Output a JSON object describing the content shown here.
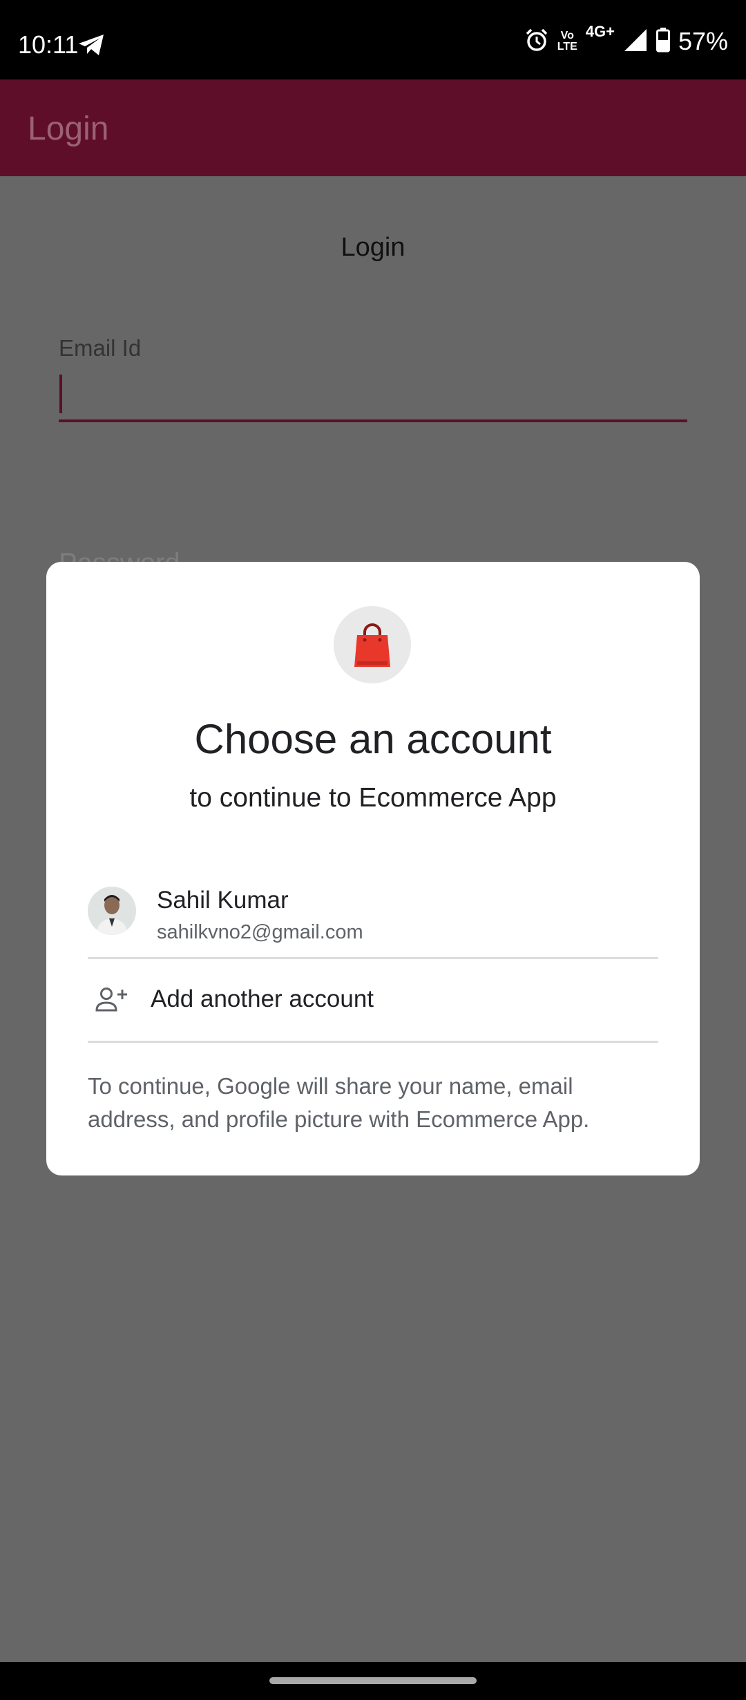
{
  "status_bar": {
    "time": "10:11",
    "volte_top": "Vo",
    "volte_bottom": "LTE",
    "network": "4G+",
    "battery": "57%"
  },
  "app_bar": {
    "title": "Login"
  },
  "login_form": {
    "heading": "Login",
    "email_label": "Email Id",
    "email_value": "",
    "password_label": "Password"
  },
  "dialog": {
    "title": "Choose an account",
    "subtitle": "to continue to Ecommerce App",
    "account": {
      "name": "Sahil Kumar",
      "email": "sahilkvno2@gmail.com"
    },
    "add_account_label": "Add another account",
    "disclaimer": "To continue, Google will share your name, email address, and profile picture with Ecommerce App."
  },
  "colors": {
    "app_bar": "#5f0e29",
    "scrim_background": "#676767",
    "logo_bag": "#e8382b"
  },
  "icons": [
    "telegram-icon",
    "alarm-icon",
    "signal-icon",
    "battery-icon",
    "shopping-bag-icon",
    "add-person-icon"
  ]
}
